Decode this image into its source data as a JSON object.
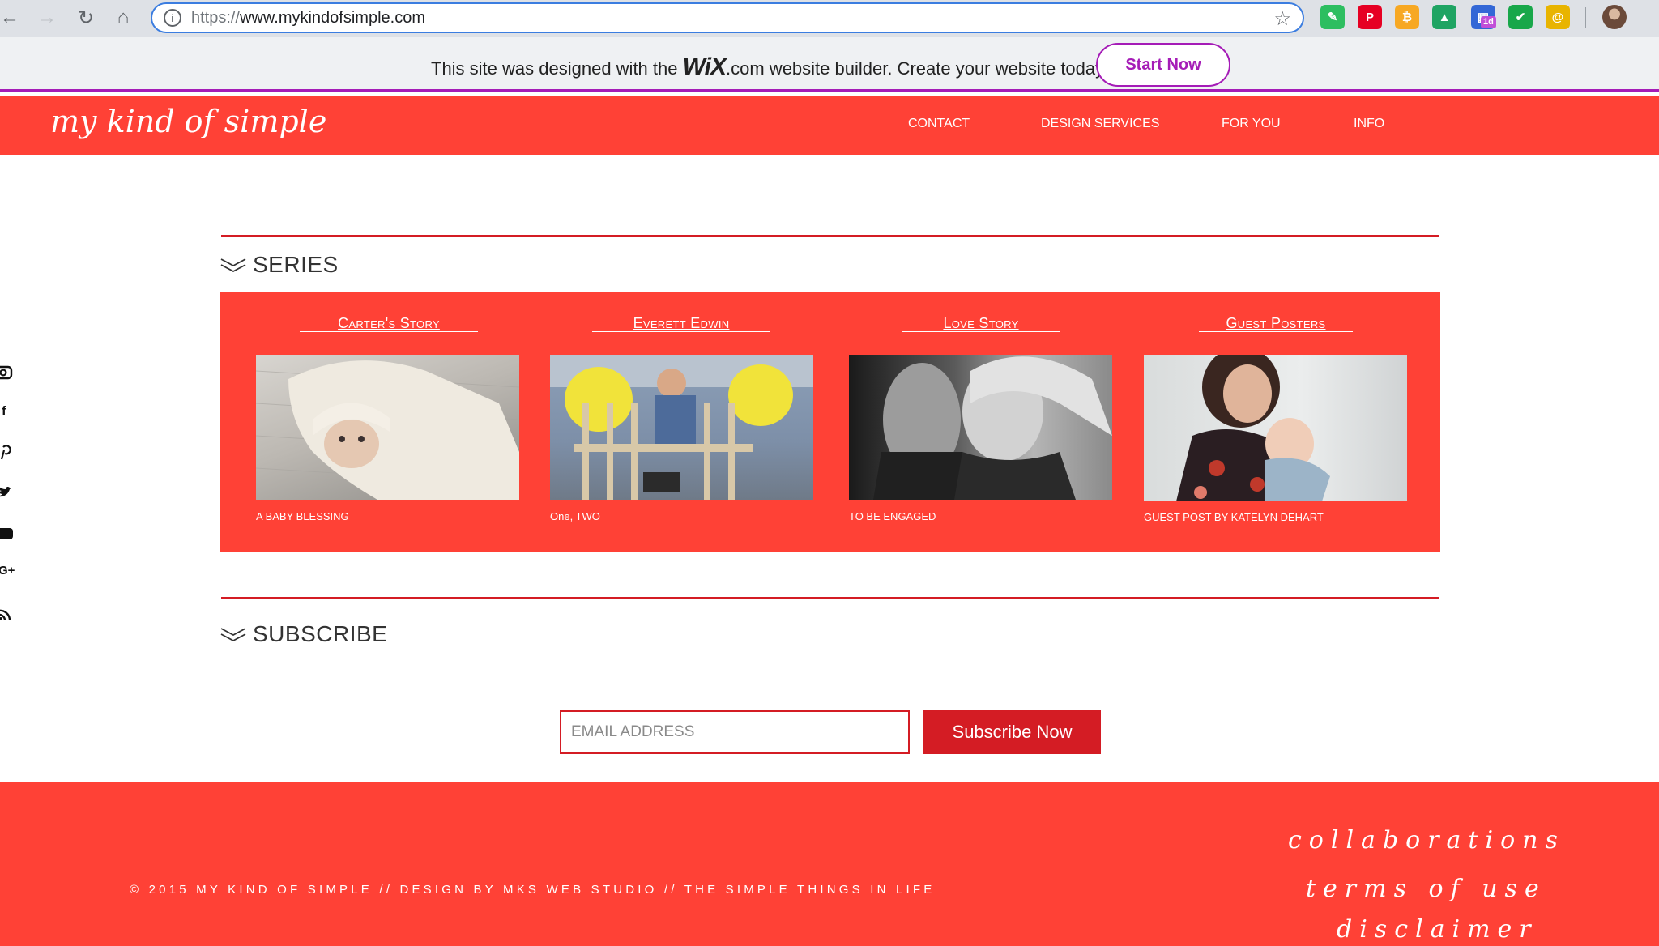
{
  "browser": {
    "url_scheme": "https://",
    "url_host": "www.mykindofsimple.com",
    "extensions": [
      {
        "name": "evernote-icon",
        "color": "#2dbe60",
        "glyph": "✎"
      },
      {
        "name": "pinterest-icon",
        "color": "#e60023",
        "glyph": "P"
      },
      {
        "name": "honey-icon",
        "color": "#f7a823",
        "glyph": "₿"
      },
      {
        "name": "google-drive-icon",
        "color": "#1fa463",
        "glyph": "▲"
      },
      {
        "name": "calendar-icon",
        "color": "#3367d6",
        "glyph": "▦"
      },
      {
        "name": "checkmark-icon",
        "color": "#18a74a",
        "glyph": "✔"
      },
      {
        "name": "rakuten-icon",
        "color": "#e8b400",
        "glyph": "@"
      }
    ],
    "calendar_badge": "1d"
  },
  "wix_banner": {
    "text_before": "This site was designed with the ",
    "logo": "WiX",
    "text_after": ".com website builder. Create your website today.",
    "button": "Start Now",
    "accent": "#a51cb7"
  },
  "header": {
    "logo": "my kind of simple",
    "menu": [
      "CONTACT",
      "DESIGN SERVICES",
      "FOR YOU",
      "INFO"
    ],
    "background": "#ff4136"
  },
  "social": [
    "instagram-icon",
    "facebook-icon",
    "pinterest-icon",
    "twitter-icon",
    "youtube-icon",
    "google-plus-icon",
    "rss-icon"
  ],
  "series": {
    "title": "SERIES",
    "cards": [
      {
        "title": "Carter's Story",
        "subtitle": "A BABY BLESSING"
      },
      {
        "title": "Everett Edwin",
        "subtitle": "One, TWO"
      },
      {
        "title": "Love Story",
        "subtitle": "TO BE ENGAGED"
      },
      {
        "title": "Guest Posters",
        "subtitle": "GUEST POST BY KATELYN DEHART"
      }
    ]
  },
  "subscribe": {
    "title": "SUBSCRIBE",
    "placeholder": "EMAIL ADDRESS",
    "button": "Subscribe Now"
  },
  "footer": {
    "copyright": "© 2015 MY KIND OF SIMPLE // DESIGN BY MKS WEB STUDIO // THE SIMPLE THINGS IN LIFE",
    "links": [
      "collaborations",
      "terms of use",
      "disclaimer"
    ]
  }
}
